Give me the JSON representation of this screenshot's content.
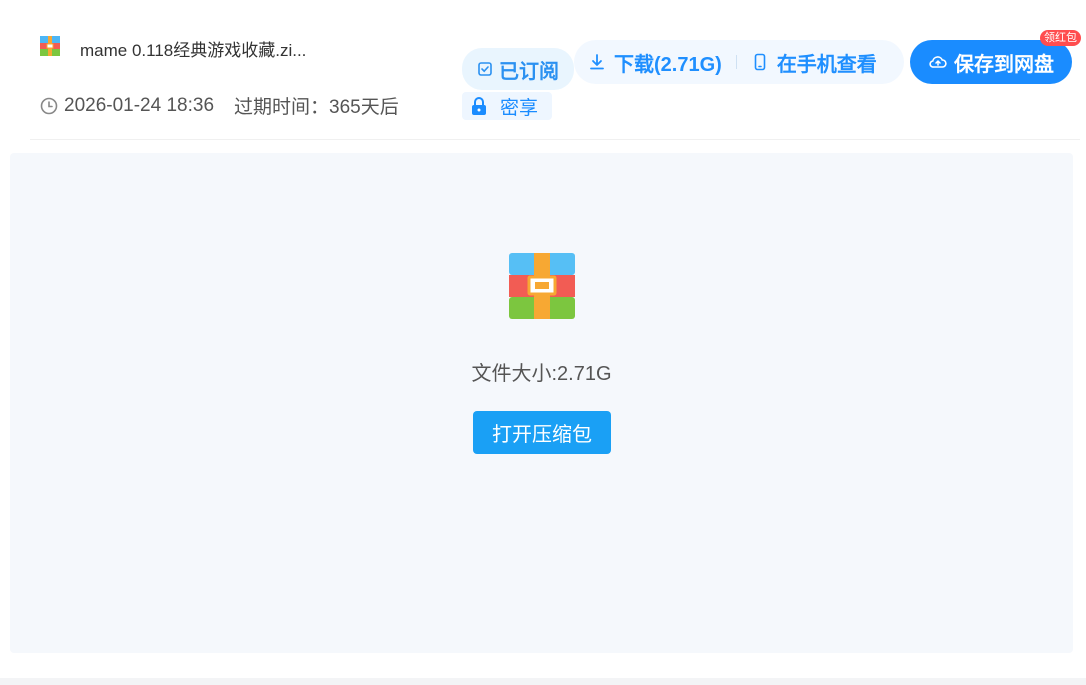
{
  "header": {
    "file_name": "mame 0.118经典游戏收藏.zi...",
    "timestamp": "2026-01-24 18:36",
    "expiry": "过期时间：365天后",
    "subscribed_label": "已订阅",
    "download_label": "下载(2.71G)",
    "phone_view_label": "在手机查看",
    "save_label": "保存到网盘",
    "badge_label": "领红包",
    "lock_label": "密享"
  },
  "preview": {
    "file_size": "文件大小:2.71G",
    "open_label": "打开压缩包"
  },
  "colors": {
    "accent": "#1a8cff",
    "open_button": "#1aa0f5",
    "badge": "#ff4d4f",
    "panel_bg": "#f5f8fc"
  },
  "icons": {
    "file": "zip-archive-icon",
    "clock": "clock-icon",
    "subscribed": "bookmark-check-icon",
    "download": "download-icon",
    "phone": "phone-icon",
    "save": "cloud-upload-icon",
    "lock": "lock-icon"
  }
}
